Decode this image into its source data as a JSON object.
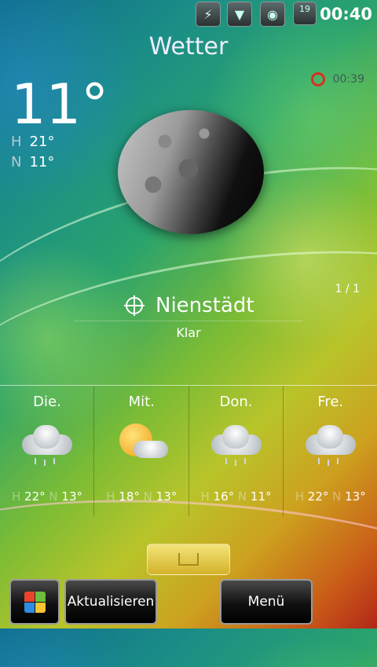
{
  "statusbar": {
    "icons": [
      "usb-icon",
      "signal-icon",
      "volume-icon",
      "battery-icon"
    ],
    "battery_label": "19",
    "time": "00:40"
  },
  "app": {
    "title": "Wetter"
  },
  "current": {
    "temperature": "11°",
    "high_label": "H",
    "high_value": "21°",
    "low_label": "N",
    "low_value": "11°",
    "sync_time": "00:39",
    "location": "Nienstädt",
    "condition": "Klar",
    "pager": "1 / 1"
  },
  "forecast": [
    {
      "day": "Die.",
      "icon": "cloudy-rain-icon",
      "high_label": "H",
      "high": "22°",
      "low_label": "N",
      "low": "13°"
    },
    {
      "day": "Mit.",
      "icon": "partly-cloudy-icon",
      "high_label": "H",
      "high": "18°",
      "low_label": "N",
      "low": "13°"
    },
    {
      "day": "Don.",
      "icon": "cloudy-rain-icon",
      "high_label": "H",
      "high": "16°",
      "low_label": "N",
      "low": "11°"
    },
    {
      "day": "Fre.",
      "icon": "cloudy-rain-icon",
      "high_label": "H",
      "high": "22°",
      "low_label": "N",
      "low": "13°"
    }
  ],
  "softkeys": {
    "refresh_label": "Aktualisieren",
    "menu_label": "Menü"
  },
  "colors": {
    "accent_sync": "#d83020"
  }
}
